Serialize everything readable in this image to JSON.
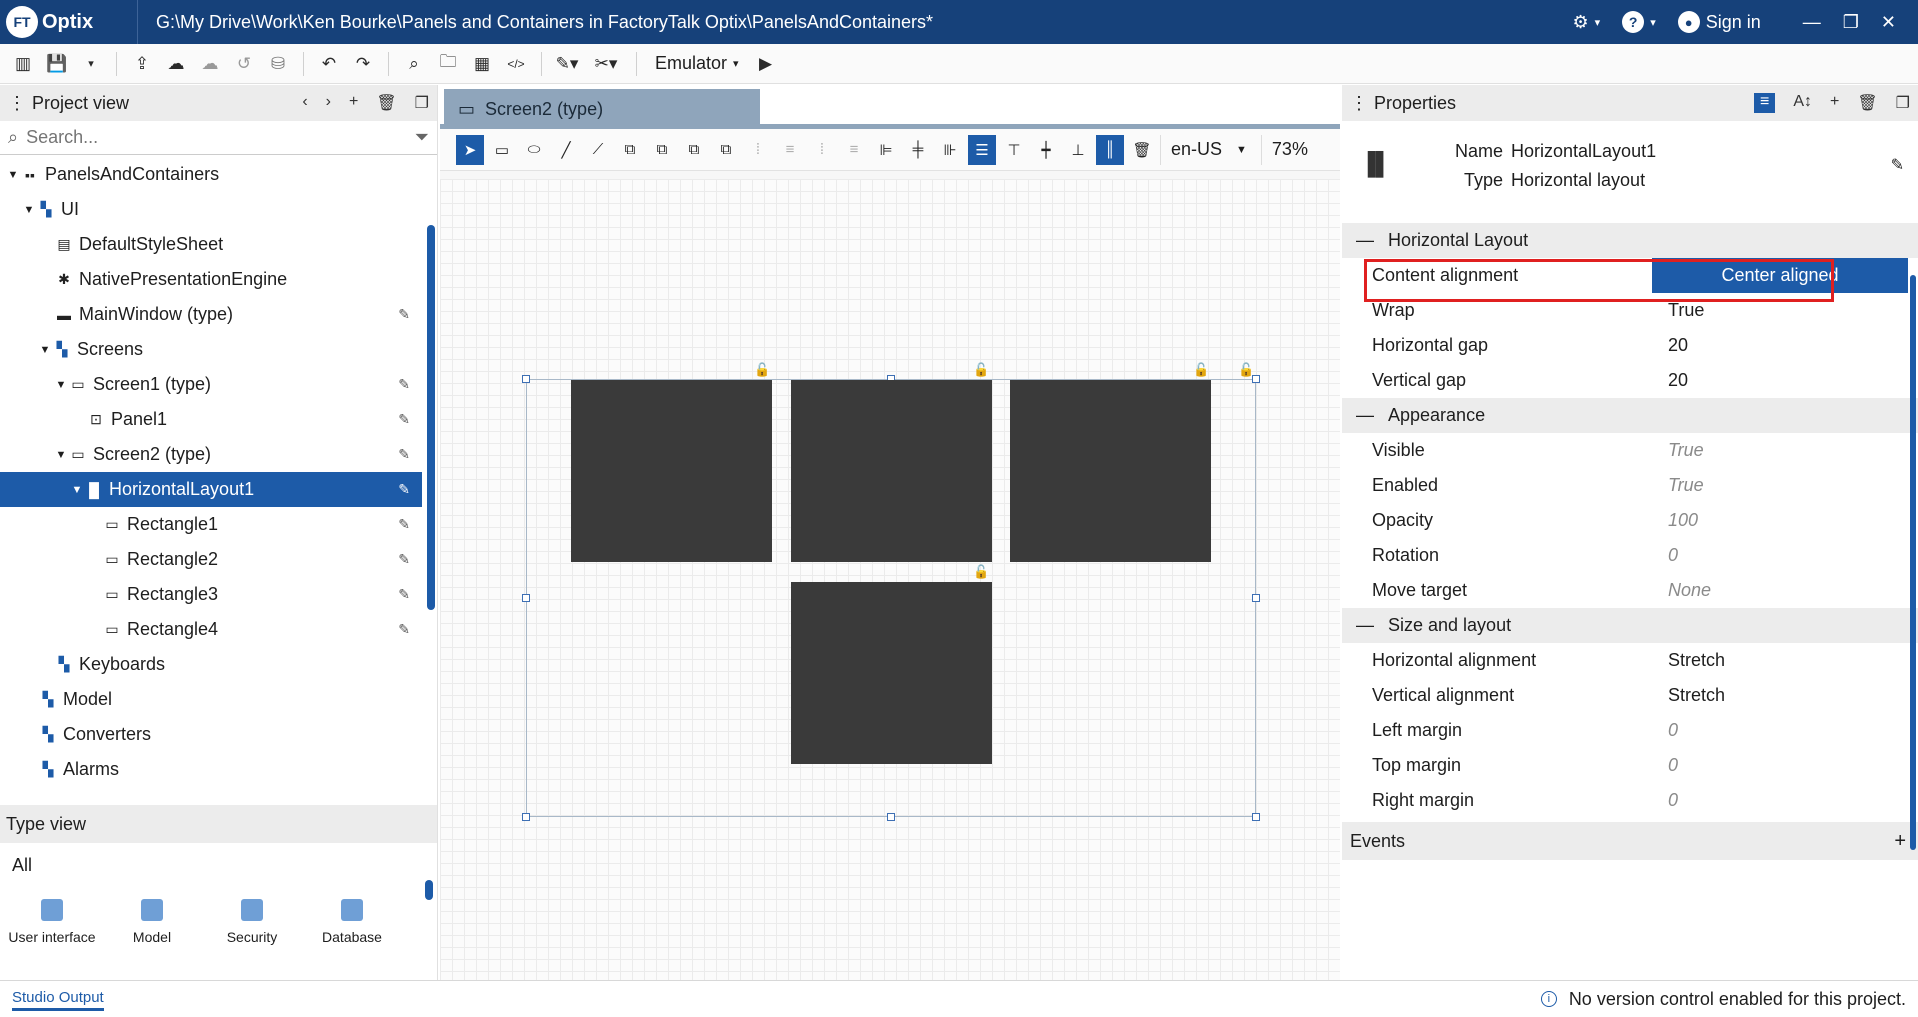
{
  "app": {
    "logo_text": "Optix",
    "logo_mark": "FT",
    "title_path": "G:\\My Drive\\Work\\Ken Bourke\\Panels and Containers in FactoryTalk Optix\\PanelsAndContainers*",
    "sign_in": "Sign in"
  },
  "toolbar": {
    "emulator_label": "Emulator"
  },
  "project_view": {
    "title": "Project view",
    "search_placeholder": "Search...",
    "tree": [
      {
        "label": "PanelsAndContainers",
        "icon": "grid-icon"
      },
      {
        "label": "UI",
        "icon": "folder-icon"
      },
      {
        "label": "DefaultStyleSheet",
        "icon": "stylesheet-icon"
      },
      {
        "label": "NativePresentationEngine",
        "icon": "gear-icon"
      },
      {
        "label": "MainWindow (type)",
        "icon": "window-icon"
      },
      {
        "label": "Screens",
        "icon": "folder-icon"
      },
      {
        "label": "Screen1 (type)",
        "icon": "monitor-icon"
      },
      {
        "label": "Panel1",
        "icon": "panel-icon"
      },
      {
        "label": "Screen2 (type)",
        "icon": "monitor-icon"
      },
      {
        "label": "HorizontalLayout1",
        "icon": "horizontal-layout-icon"
      },
      {
        "label": "Rectangle1",
        "icon": "rectangle-icon"
      },
      {
        "label": "Rectangle2",
        "icon": "rectangle-icon"
      },
      {
        "label": "Rectangle3",
        "icon": "rectangle-icon"
      },
      {
        "label": "Rectangle4",
        "icon": "rectangle-icon"
      },
      {
        "label": "Keyboards",
        "icon": "folder-icon"
      },
      {
        "label": "Model",
        "icon": "folder-icon"
      },
      {
        "label": "Converters",
        "icon": "folder-icon"
      },
      {
        "label": "Alarms",
        "icon": "folder-icon"
      }
    ]
  },
  "type_view": {
    "title": "Type view",
    "filter": "All",
    "items": [
      {
        "label": "User interface"
      },
      {
        "label": "Model"
      },
      {
        "label": "Security"
      },
      {
        "label": "Database"
      }
    ]
  },
  "editor": {
    "tab_label": "Screen2 (type)",
    "locale": "en-US",
    "zoom": "73%"
  },
  "properties": {
    "title": "Properties",
    "name_label": "Name",
    "name_value": "HorizontalLayout1",
    "type_label": "Type",
    "type_value": "Horizontal layout",
    "sections": [
      {
        "title": "Horizontal Layout",
        "rows": [
          {
            "key": "Content alignment",
            "value": "Center aligned"
          },
          {
            "key": "Wrap",
            "value": "True"
          },
          {
            "key": "Horizontal gap",
            "value": "20"
          },
          {
            "key": "Vertical gap",
            "value": "20"
          }
        ]
      },
      {
        "title": "Appearance",
        "rows": [
          {
            "key": "Visible",
            "value": "True"
          },
          {
            "key": "Enabled",
            "value": "True"
          },
          {
            "key": "Opacity",
            "value": "100"
          },
          {
            "key": "Rotation",
            "value": "0"
          },
          {
            "key": "Move target",
            "value": "None"
          }
        ]
      },
      {
        "title": "Size and layout",
        "rows": [
          {
            "key": "Horizontal alignment",
            "value": "Stretch"
          },
          {
            "key": "Vertical alignment",
            "value": "Stretch"
          },
          {
            "key": "Left margin",
            "value": "0"
          },
          {
            "key": "Top margin",
            "value": "0"
          },
          {
            "key": "Right margin",
            "value": "0"
          }
        ]
      }
    ],
    "events_label": "Events"
  },
  "status": {
    "tab_label": "Studio Output",
    "message": "No version control enabled for this project."
  },
  "colors": {
    "titlebar": "#16417a",
    "accent": "#1d5ba8",
    "highlight_border": "#e02020",
    "rectangle_fill": "#3a3a3a"
  }
}
